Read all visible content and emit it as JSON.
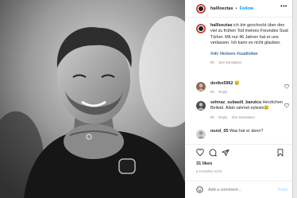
{
  "post": {
    "username": "hallloeztas",
    "follow_label": "Follow",
    "more_label": "•••",
    "caption_user": "hallloeztas",
    "caption_text": "ich bin geschockt über den viel zu frühen Tod meines Freundes Suat Türker. Mit nur 46 Jahren hat er uns verlassen. Ich kann es nicht glauben.",
    "hashtags": "#ofc #kickers #suattürker",
    "caption_meta": {
      "age": "8h",
      "translation": "See translation"
    }
  },
  "comments": [
    {
      "user": "doriko5962",
      "text": "😢",
      "age": "8h",
      "reply": "Reply"
    },
    {
      "user": "sehnaz_subasili_barutcu",
      "text": "Herzlichen Beileid. Allah rahmet eylesin😢",
      "age": "8h",
      "reply": "Reply",
      "translation": "See translation"
    },
    {
      "user": "nurol_05",
      "text": "Was hat er denn?"
    }
  ],
  "likes": "31 likes",
  "date": "6 HOURS AGO",
  "add_comment": {
    "placeholder": "Add a comment...",
    "post_label": "Post"
  },
  "colors": {
    "accent": "#0095f6",
    "post_disabled": "#b3dbff",
    "muted": "#8e8e8e",
    "avatar_ring": "#c4302b"
  },
  "icons": [
    "heart-icon",
    "comment-icon",
    "share-icon",
    "bookmark-icon",
    "emoji-icon",
    "more-icon"
  ]
}
